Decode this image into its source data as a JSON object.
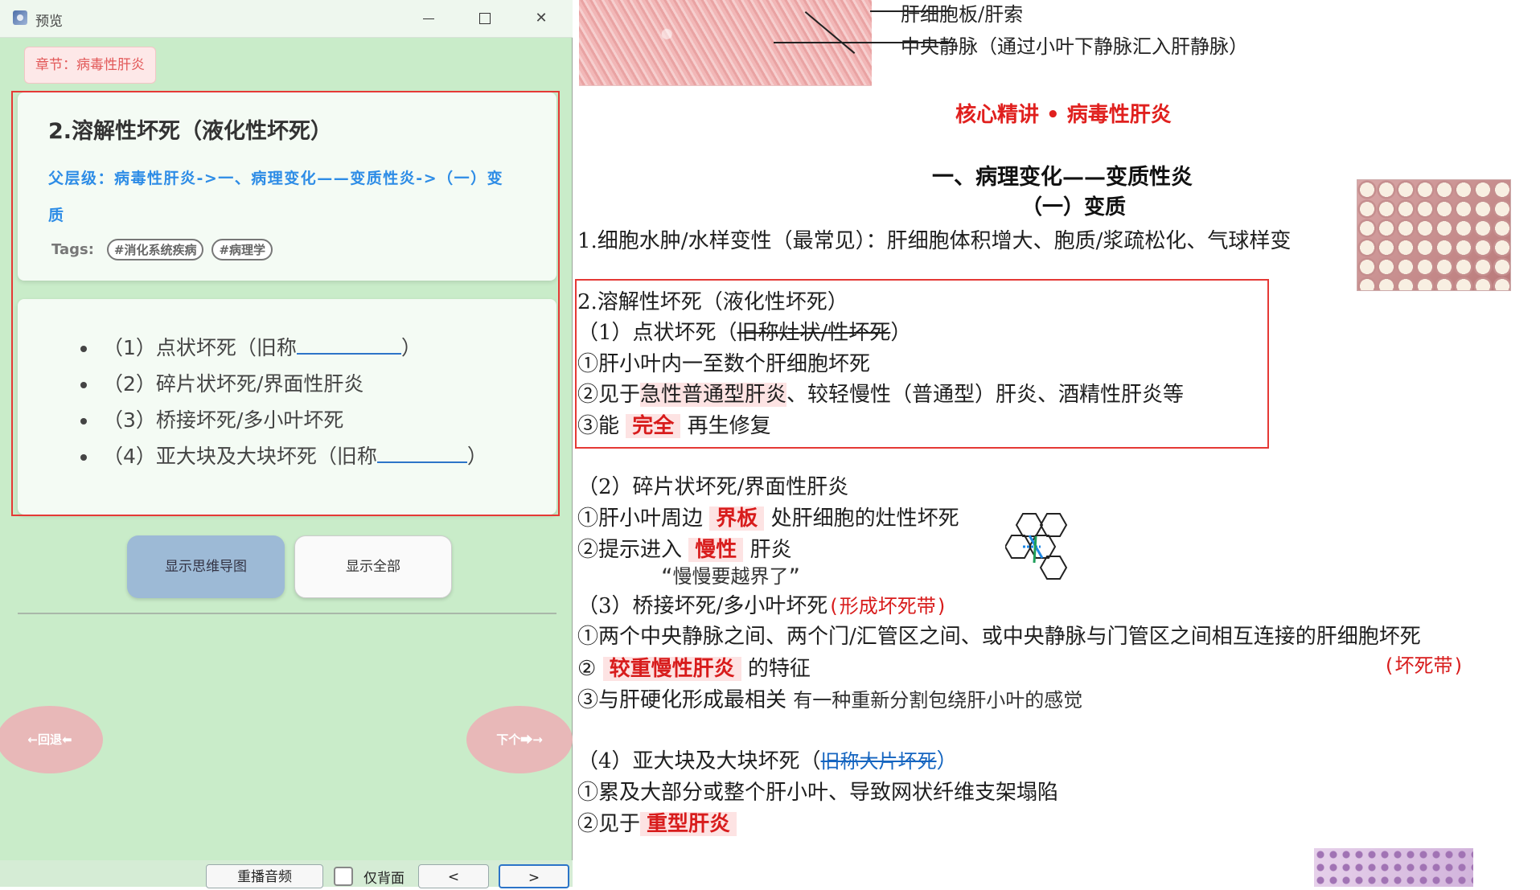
{
  "window": {
    "title": "预览"
  },
  "chapter_tag": "章节：病毒性肝炎",
  "card_front": {
    "title": "2.溶解性坏死（液化性坏死）",
    "parent_line1": "父层级：病毒性肝炎->一、病理变化——变质性炎->（一）变",
    "parent_line2": "质",
    "tags_label": "Tags:",
    "tags": [
      "#消化系统疾病",
      "#病理学"
    ]
  },
  "card_back": {
    "items": [
      {
        "text": "（1）点状坏死（旧称",
        "suffix": "）"
      },
      {
        "text": "（2）碎片状坏死/界面性肝炎"
      },
      {
        "text": "（3）桥接坏死/多小叶坏死"
      },
      {
        "text": "（4）亚大块及大块坏死（旧称",
        "suffix": "）"
      }
    ]
  },
  "buttons": {
    "mindmap": "显示思维导图",
    "show_all": "显示全部"
  },
  "nav": {
    "prev": "←回退⬅",
    "next": "下个⮕→"
  },
  "bottom_bar": {
    "replay": "重播音频",
    "back_only": "仅背面",
    "prev": "<",
    "next": ">"
  },
  "doc": {
    "top_label_1": "肝细胞板/肝索",
    "top_label_2": "中央静脉（通过小叶下静脉汇入肝静脉）",
    "heading_red": "核心精讲 • 病毒性肝炎",
    "heading": "一、病理变化——变质性炎",
    "subheading": "（一）变质",
    "line_1": "1.细胞水肿/水样变性（最常见）：肝细胞体积增大、胞质/浆疏松化、气球样变",
    "sec2": {
      "title": "2.溶解性坏死（液化性坏死）",
      "p1_pre": "（1）点状坏死（",
      "p1_strike": "旧称灶状/性坏死",
      "p1_post": "）",
      "p1_a": "①肝小叶内一至数个肝细胞坏死",
      "p1_b_pre": "②见于",
      "p1_b_hl": "急性普通型肝炎",
      "p1_b_post": "、较轻慢性（普通型）肝炎、酒精性肝炎等",
      "p1_c_pre": "③能",
      "p1_c_hl": "完全",
      "p1_c_post": "再生修复"
    },
    "p2": {
      "title": "（2）碎片状坏死/界面性肝炎",
      "a_pre": "①肝小叶周边",
      "a_hl": "界板",
      "a_post": "处肝细胞的灶性坏死",
      "b_pre": "②提示进入",
      "b_hl": "慢性",
      "b_post": "肝炎",
      "quote": "“慢慢要越界了”"
    },
    "p3": {
      "title": "（3）桥接坏死/多小叶坏死",
      "title_note": "(形成坏死带)",
      "a": "①两个中央静脉之间、两个门/汇管区之间、或中央静脉与门管区之间相互连接的肝细胞坏死",
      "b_pre": "②",
      "b_hl": "较重慢性肝炎",
      "b_post": "的特征",
      "b_note": "(坏死带)",
      "c": "③与肝硬化形成最相关",
      "c_note": "有一种重新分割包绕肝小叶的感觉"
    },
    "p4": {
      "title_pre": "（4）亚大块及大块坏死（",
      "title_strike": "旧称大片坏死",
      "title_post": "）",
      "a": "①累及大部分或整个肝小叶、导致网状纤维支架塌陷",
      "b_pre": "②见于",
      "b_hl": "重型肝炎"
    }
  }
}
